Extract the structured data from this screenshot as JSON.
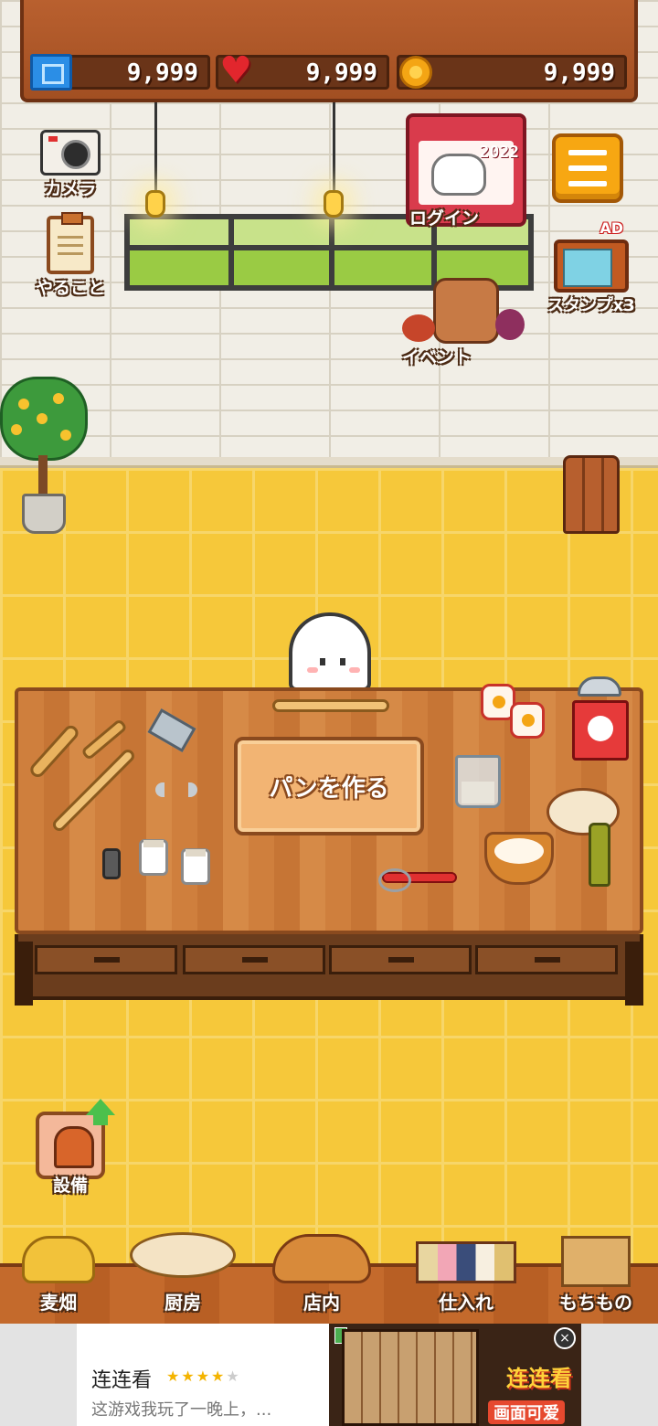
{
  "resources": {
    "tickets": "9,999",
    "hearts": "9,999",
    "coins": "9,999"
  },
  "side_buttons": {
    "camera": "カメラ",
    "todo": "やること",
    "login": "ログイン",
    "login_year": "2022",
    "stamp": "スタンプx3",
    "ad_badge": "AD",
    "event": "イベント",
    "equipment": "設備"
  },
  "table": {
    "make_bread_label": "パンを作る"
  },
  "nav": {
    "items": [
      {
        "label": "麦畑",
        "icon": "wheat-field-icon"
      },
      {
        "label": "厨房",
        "icon": "kitchen-icon"
      },
      {
        "label": "店内",
        "icon": "shop-icon"
      },
      {
        "label": "仕入れ",
        "icon": "supply-icon"
      },
      {
        "label": "もちもの",
        "icon": "items-box-icon"
      }
    ]
  },
  "ad": {
    "title": "连连看",
    "rating": 4,
    "description": "这游戏我玩了一晚上，...",
    "brand": "连连看",
    "subtitle": "画面可爱",
    "close_glyph": "×"
  },
  "colors": {
    "wall": "#f1eee6",
    "floor": "#f6c83a",
    "wood": "#b9602f",
    "menu_button": "#f7a712",
    "login_card": "#d93b4c"
  }
}
